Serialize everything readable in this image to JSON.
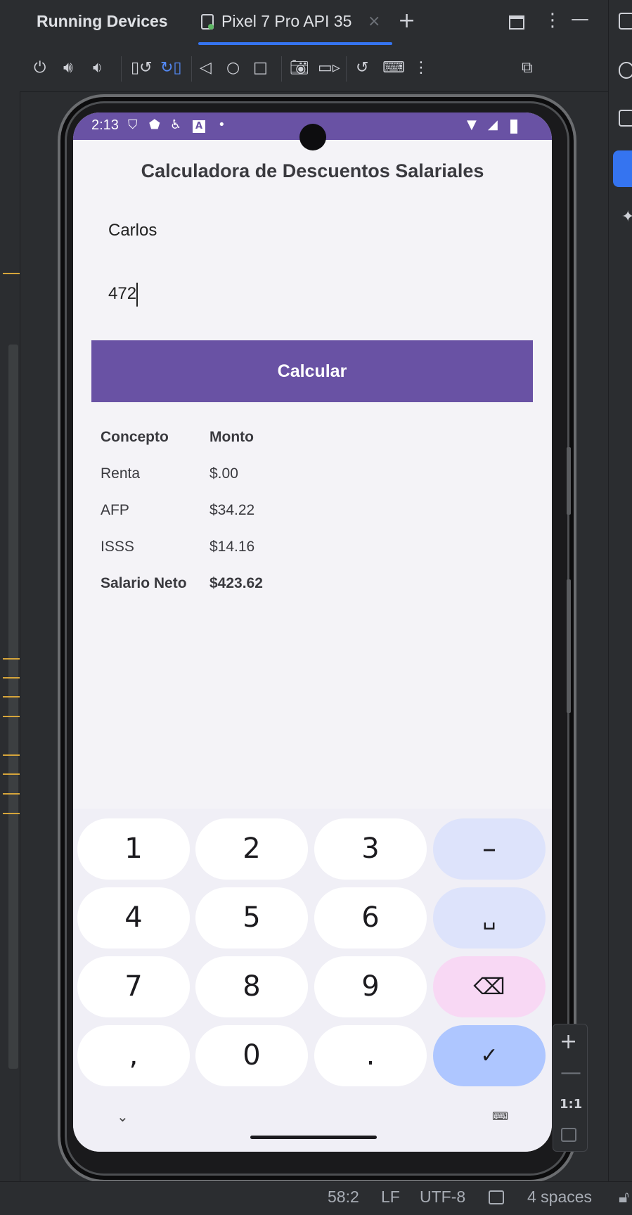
{
  "ide": {
    "panel_title": "Running Devices",
    "device_tab": "Pixel 7 Pro API 35",
    "close_glyph": "×",
    "add_glyph": "+",
    "more_glyph": "⋮",
    "minimize_glyph": "—",
    "toolbar_icons": [
      "power-icon",
      "volume-up-icon",
      "volume-down-icon",
      "rotate-left-icon",
      "rotate-right-icon",
      "back-icon",
      "home-icon",
      "overview-icon",
      "camera-icon",
      "record-icon",
      "reset-icon",
      "keyboard-icon",
      "more-icon",
      "inspect-icon"
    ],
    "status": {
      "position": "58:2",
      "line_ending": "LF",
      "encoding": "UTF-8",
      "indent": "4 spaces"
    },
    "zoom": {
      "in": "+",
      "out": "—",
      "fit": "1:1"
    },
    "accent_color": "#3574f0"
  },
  "phone": {
    "status_bar": {
      "time": "2:13",
      "icons": [
        "shield-icon",
        "vpn-icon",
        "accessibility-icon",
        "app-icon",
        "dot-icon",
        "wifi-icon",
        "signal-icon",
        "battery-icon"
      ]
    },
    "app": {
      "title": "Calculadora de Descuentos Salariales",
      "name_value": "Carlos",
      "salary_value": "472",
      "button_label": "Calcular",
      "primary_color": "#6952a4",
      "table": {
        "headers": [
          "Concepto",
          "Monto"
        ],
        "rows": [
          {
            "concept": "Renta",
            "amount": "$.00"
          },
          {
            "concept": "AFP",
            "amount": "$34.22"
          },
          {
            "concept": "ISSS",
            "amount": "$14.16"
          }
        ],
        "total": {
          "concept": "Salario Neto",
          "amount": "$423.62"
        }
      }
    },
    "keyboard": {
      "keys": [
        [
          "1",
          "2",
          "3",
          "–"
        ],
        [
          "4",
          "5",
          "6",
          "␣"
        ],
        [
          "7",
          "8",
          "9",
          "⌫"
        ],
        [
          ",",
          "0",
          ".",
          "✓"
        ]
      ],
      "hide_glyph": "⌄",
      "switch_glyph": "⌨"
    }
  }
}
